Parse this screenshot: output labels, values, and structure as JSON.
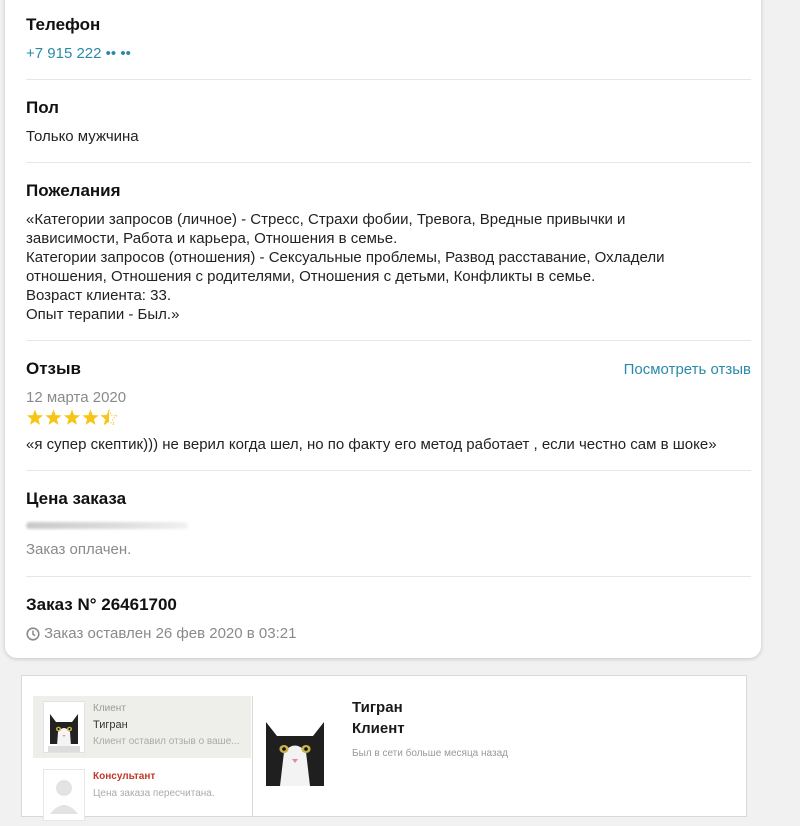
{
  "phone": {
    "heading": "Телефон",
    "value": "+7 915 222 •• ••"
  },
  "gender": {
    "heading": "Пол",
    "value": "Только мужчина"
  },
  "wishes": {
    "heading": "Пожелания",
    "lines": [
      "«Категории запросов (личное) - Стресс, Страхи фобии, Тревога, Вредные привычки и",
      "зависимости, Работа и карьера, Отношения в семье.",
      "Категории запросов (отношения) - Сексуальные проблемы, Развод расставание, Охладели",
      "отношения, Отношения с родителями, Отношения с детьми, Конфликты в семье.",
      "Возраст клиента: 33.",
      "Опыт терапии - Был.»"
    ]
  },
  "review": {
    "heading": "Отзыв",
    "view_link": "Посмотреть отзыв",
    "date": "12 марта 2020",
    "rating": 4.5,
    "rating_max": 5,
    "star_color": "#f5c518",
    "text": "«я супер скептик))) не верил когда шел, но по факту его метод работает , если честно сам в шоке»"
  },
  "price": {
    "heading": "Цена заказа",
    "status": "Заказ оплачен."
  },
  "order": {
    "heading": "Заказ N° 26461700",
    "created_icon": "clock-icon",
    "created": "Заказ оставлен 26 фев 2020 в 03:21"
  },
  "chat": {
    "conversations": [
      {
        "role": "Клиент",
        "name": "Тигран",
        "preview": "Клиент оставил отзыв о ваше..."
      },
      {
        "role": "Консультант",
        "name": "",
        "preview": "Цена заказа пересчитана."
      }
    ],
    "consultant_role_color": "#c0392b",
    "active": {
      "name": "Тигран",
      "role": "Клиент",
      "status": "Был в сети больше месяца назад"
    }
  }
}
